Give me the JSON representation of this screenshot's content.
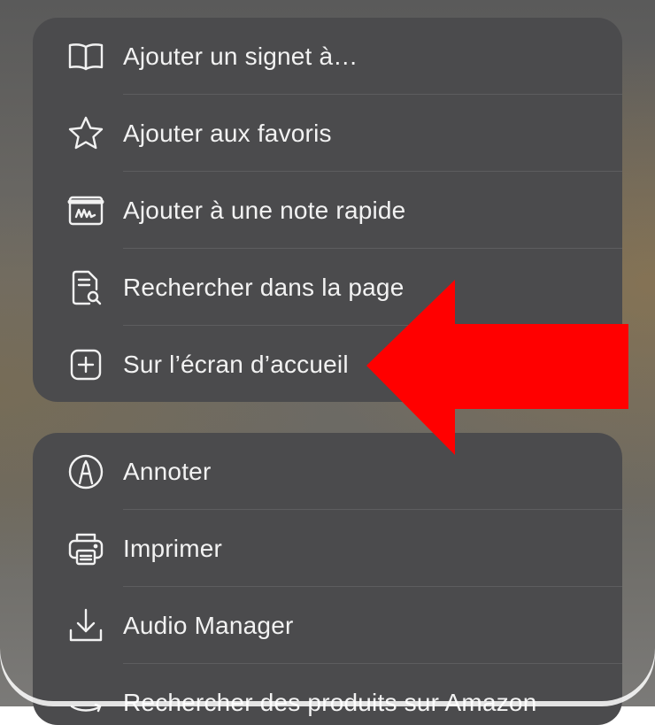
{
  "group_primary": {
    "items": [
      {
        "label": "Ajouter un signet à…",
        "icon": "book-icon"
      },
      {
        "label": "Ajouter aux favoris",
        "icon": "star-icon"
      },
      {
        "label": "Ajouter à une note rapide",
        "icon": "quick-note-icon"
      },
      {
        "label": "Rechercher dans la page",
        "icon": "find-in-page-icon"
      },
      {
        "label": "Sur l’écran d’accueil",
        "icon": "plus-square-icon"
      }
    ]
  },
  "group_secondary": {
    "items": [
      {
        "label": "Annoter",
        "icon": "markup-pen-icon"
      },
      {
        "label": "Imprimer",
        "icon": "printer-icon"
      },
      {
        "label": "Audio Manager",
        "icon": "download-icon"
      },
      {
        "label": "Rechercher des produits sur Amazon",
        "icon": "amazon-icon"
      }
    ]
  },
  "annotation": {
    "arrow_color": "#ff0000",
    "points_to": "Sur l’écran d’accueil"
  },
  "colors": {
    "menu_background": "#4b4b4d",
    "text": "#f2f2f2",
    "icon": "#f2f2f2"
  }
}
